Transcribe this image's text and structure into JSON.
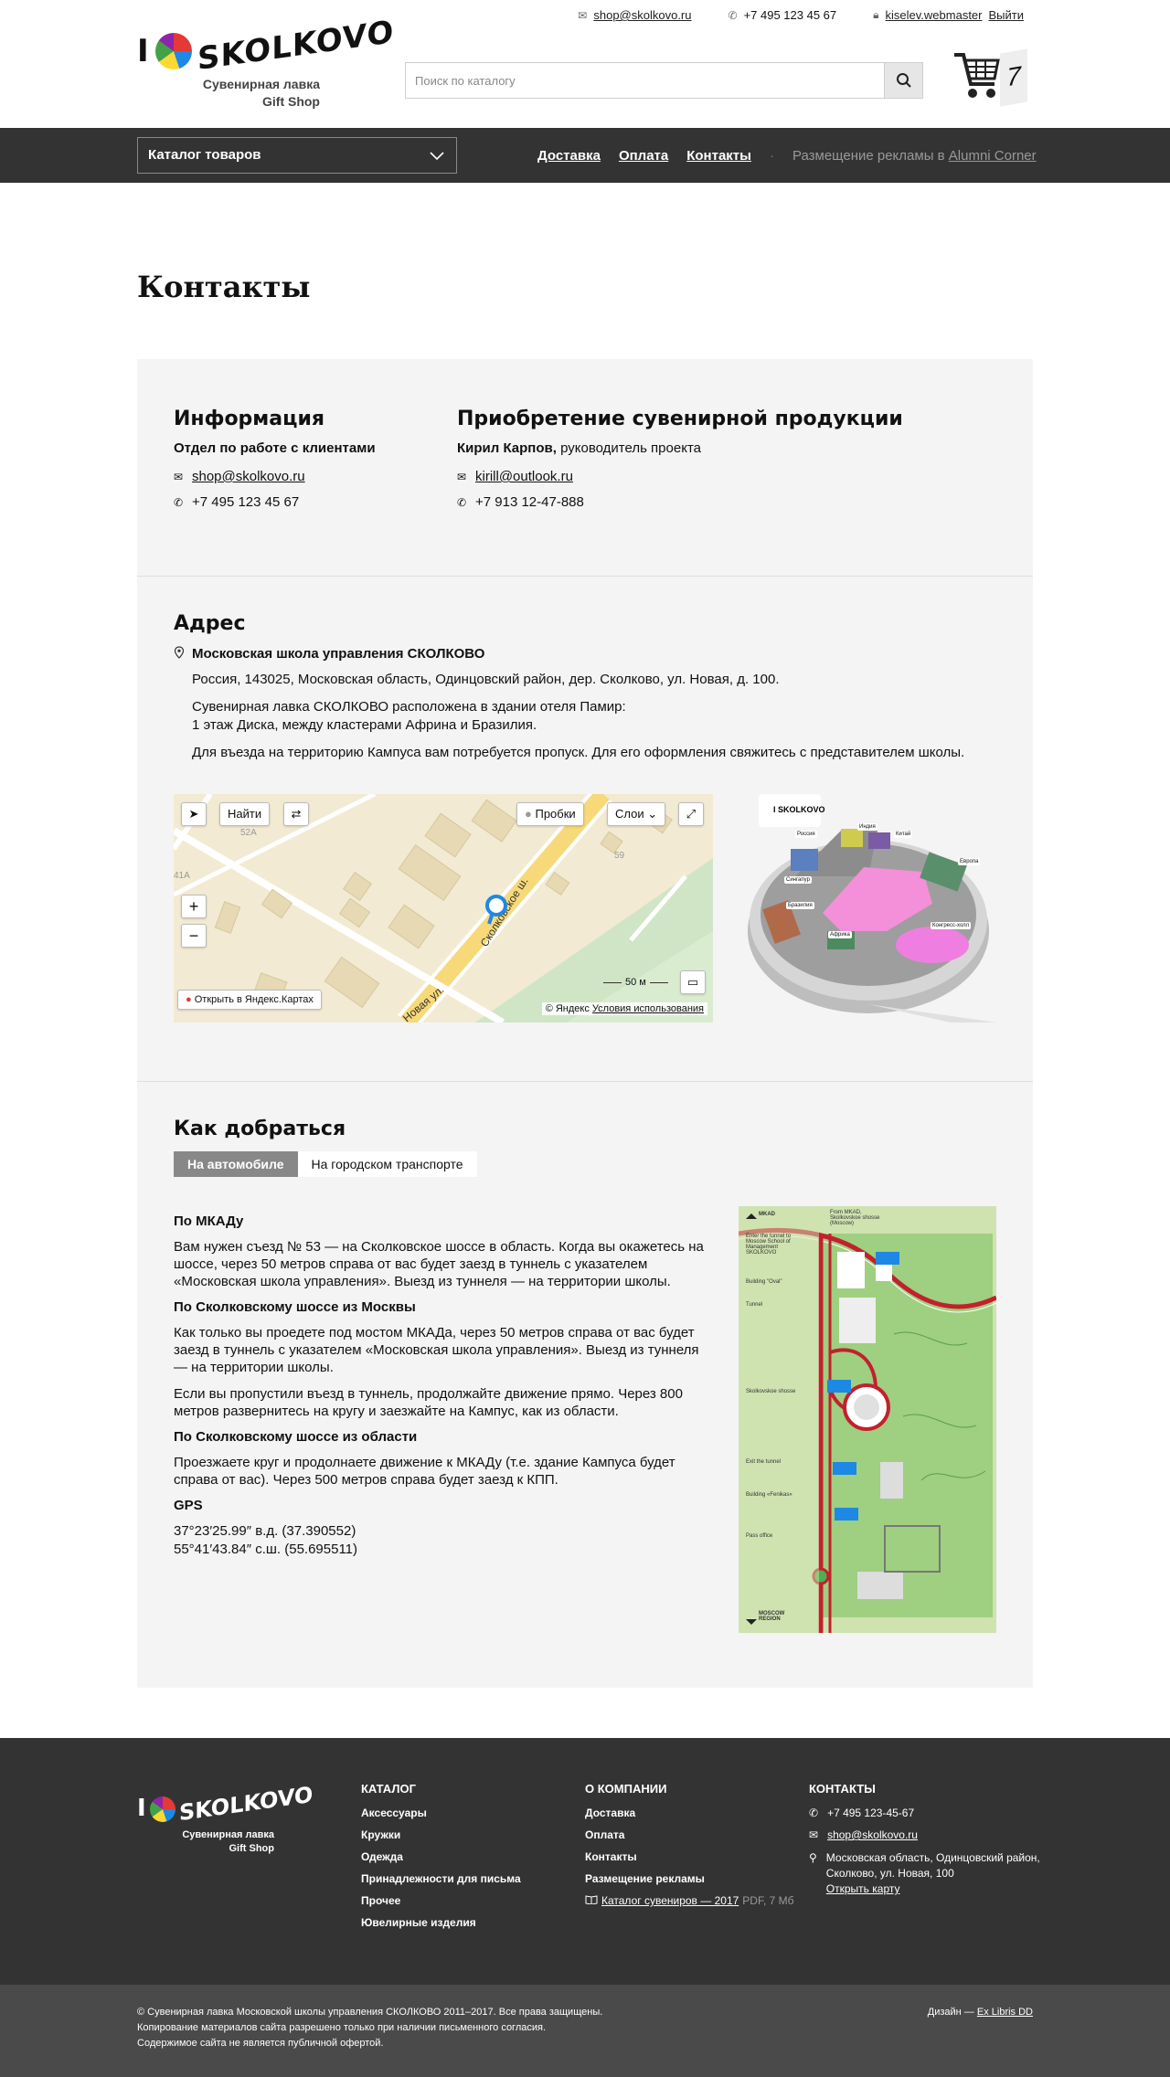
{
  "header": {
    "logo_text": "I SKOLKOVO",
    "logo_sub1": "Сувенирная лавка",
    "logo_sub2": "Gift Shop",
    "email": "shop@skolkovo.ru",
    "phone": "+7 495 123 45 67",
    "user": "kiselev.webmaster",
    "logout": "Выйти",
    "search_placeholder": "Поиск по каталогу",
    "cart_count": "7"
  },
  "nav": {
    "catalog_label": "Каталог товаров",
    "links": [
      "Доставка",
      "Оплата",
      "Контакты"
    ],
    "ad_text": "Размещение рекламы в ",
    "ad_link": "Alumni Corner"
  },
  "page_title": "Контакты",
  "info": {
    "title": "Информация",
    "dept": "Отдел по работе с клиентами",
    "email": "shop@skolkovo.ru",
    "phone": "+7 495 123 45 67"
  },
  "purchase": {
    "title": "Приобретение сувенирной продукции",
    "name": "Кирил Карпов,",
    "role": " руководитель проекта",
    "email": "kirill@outlook.ru",
    "phone": "+7 913 12-47-888"
  },
  "address": {
    "title": "Адрес",
    "org": "Московская школа управления СКОЛКОВО",
    "line1": "Россия, 143025, Московская область, Одинцовский район, дер. Сколково, ул. Новая, д. 100.",
    "line2": "Сувенирная лавка СКОЛКОВО расположена в здании отеля Памир:",
    "line3": "1 этаж Диска, между кластерами Африна и Бразилия.",
    "line4": "Для въезда на территорию Кампуса вам потребуется пропуск. Для его оформления свяжитесь с представителем школы."
  },
  "map": {
    "find": "Найти",
    "traffic": "Пробки",
    "layers": "Слои",
    "open": "Открыть в Яндекс.Картах",
    "scale": "50 м",
    "copyright": "© Яндекс",
    "terms": "Условия использования",
    "street1": "Сколковское ш.",
    "street2": "Новая ул.",
    "label_52a": "52А",
    "label_41a": "41А",
    "label_59": "59"
  },
  "campus": {
    "labels": [
      "Россия",
      "Индия",
      "Китай",
      "Европа",
      "Сингапур",
      "Бразилия",
      "Африка",
      "Конгресс-холл"
    ]
  },
  "route": {
    "title": "Как добраться",
    "tabs": [
      "На автомобиле",
      "На городском транспорте"
    ],
    "h1": "По МКАДу",
    "p1": "Вам нужен съезд № 53 — на Сколковское шоссе в область. Когда вы окажетесь на шоссе, через 50 метров справа от вас будет заезд в туннель с указателем «Московская школа управления». Выезд из туннеля — на территории школы.",
    "h2": "По Сколковскому шоссе из Москвы",
    "p2": "Как только вы проедете под мостом МКАДа, через 50 метров справа от вас будет заезд в туннель с указателем «Московская школа управления». Выезд из туннеля — на территории школы.",
    "p3": "Если вы пропустили въезд в туннель, продолжайте движение прямо. Через 800 метров развернитесь на кругу и заезжайте на Кампус, как из области.",
    "h3": "По Сколковскому шоссе из области",
    "p4": "Проезжаете круг и продолнаете движение к МКАДу (т.е. здание Кампуса будет справа от вас). Через 500 метров справа будет заезд к КПП.",
    "h4": "GPS",
    "gps1": "37°23′25.99″ в.д. (37.390552)",
    "gps2": "55°41′43.84″ с.ш. (55.695511)",
    "map_labels": {
      "mkad": "MKAD",
      "from": "From MKAD, Skolkovskoe shosse (Moscow)",
      "enter": "Enter the tunnel to Moscow School of Management SKOLKOVO",
      "oval": "Building \"Oval\"",
      "tunnel": "Tunnel",
      "shosse": "Skolkovskoe shosse",
      "exit": "Exit the tunnel",
      "fenikas": "Building «Fenikas»",
      "pass": "Pass office",
      "region": "MOSCOW REGION"
    }
  },
  "footer": {
    "logo_text": "I SKOLKOVO",
    "logo_sub1": "Сувенирная лавка",
    "logo_sub2": "Gift Shop",
    "catalog_title": "КАТАЛОГ",
    "catalog_items": [
      "Аксессуары",
      "Кружки",
      "Одежда",
      "Принадлежности для письма",
      "Прочее",
      "Ювелирные изделия"
    ],
    "company_title": "О КОМПАНИИ",
    "company_items": [
      "Доставка",
      "Оплата",
      "Контакты",
      "Размещение рекламы"
    ],
    "catalog_pdf": "Каталог сувениров — 2017",
    "pdf_meta": "PDF, 7 Мб",
    "contacts_title": "КОНТАКТЫ",
    "phone": "+7 495 123-45-67",
    "email": "shop@skolkovo.ru",
    "addr1": "Московская область, Одинцовский район,",
    "addr2": "Сколково, ул. Новая, 100",
    "open_map": "Открыть карту",
    "copyright": "© Сувенирная лавка Московской школы управления СКОЛКОВО 2011–2017. Все права защищены. Копирование материалов сайта разрешено только при наличии письменного согласия. Содержимое сайта не является публичной офертой.",
    "design_prefix": "Дизайн — ",
    "design_link": "Ex Libris DD"
  }
}
